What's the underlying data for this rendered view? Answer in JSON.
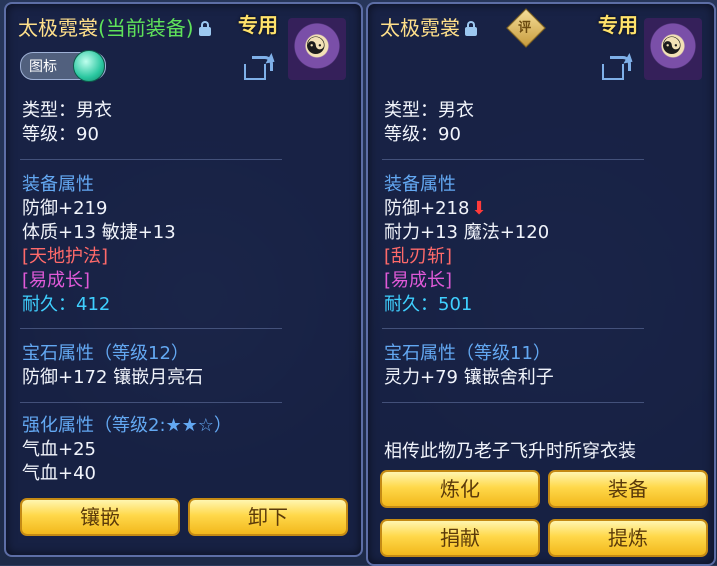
{
  "left_panel": {
    "title": "太极霓裳",
    "title_extra": "(当前装备)",
    "exclusive": "专用",
    "toggle_label": "图标",
    "type_line": "类型：男衣",
    "level_line": "等级：90",
    "section_equip": "装备属性",
    "attr1": "防御+219",
    "attr2": "体质+13 敏捷+13",
    "special1": "[天地护法]",
    "special2": "[易成长]",
    "durability": "耐久：412",
    "section_gem": "宝石属性（等级12）",
    "gem_attr": "防御+172 镶嵌月亮石",
    "section_enhance": "强化属性（等级2:★★☆）",
    "enhance1": "气血+25",
    "enhance2": "气血+40",
    "btn_inlay": "镶嵌",
    "btn_unequip": "卸下"
  },
  "right_panel": {
    "title": "太极霓裳",
    "rating_badge": "评",
    "exclusive": "专用",
    "type_line": "类型：男衣",
    "level_line": "等级：90",
    "section_equip": "装备属性",
    "attr1": "防御+218",
    "attr2": "耐力+13 魔法+120",
    "special1": "[乱刃斩]",
    "special2": "[易成长]",
    "durability": "耐久：501",
    "section_gem": "宝石属性（等级11）",
    "gem_attr": "灵力+79 镶嵌舍利子",
    "description": "相传此物乃老子飞升时所穿衣装",
    "btn_refine": "炼化",
    "btn_equip": "装备",
    "btn_donate": "捐献",
    "btn_extract": "提炼"
  },
  "colors": {
    "title": "#ffe08a",
    "current_equipped": "#5fe35a",
    "section_header": "#63a8f2",
    "special_red": "#ff6a6a",
    "special_pink": "#e05ad8",
    "durability": "#3fd0ff",
    "button_gold": "#ffd84a"
  },
  "icons": {
    "lock": "lock-icon",
    "share": "share-icon",
    "decrease": "down-arrow-icon",
    "avatar": "taiji-avatar"
  }
}
